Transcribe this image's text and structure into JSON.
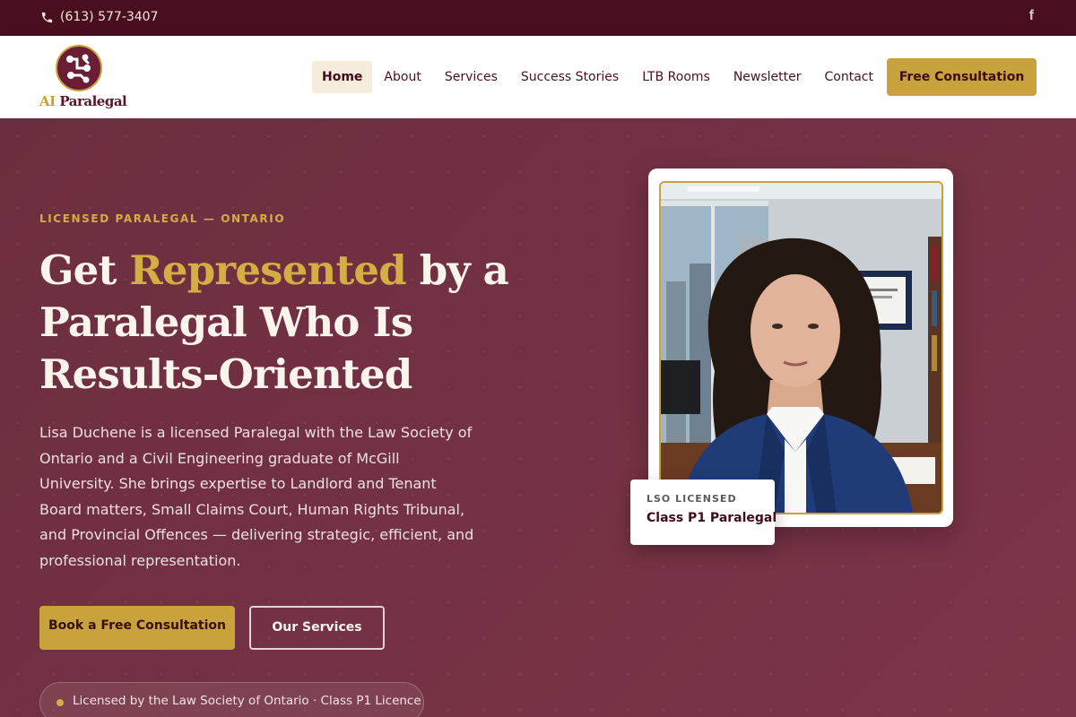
{
  "topbar": {
    "phone": "(613) 577-3407",
    "phone_icon": "phone-icon",
    "social_icon": "facebook-icon",
    "social_glyph": "f"
  },
  "header": {
    "logo_text_ai": "AI",
    "logo_text_rest": "Paralegal",
    "nav": [
      {
        "label": "Home",
        "active": true
      },
      {
        "label": "About"
      },
      {
        "label": "Services"
      },
      {
        "label": "Success Stories"
      },
      {
        "label": "LTB Rooms"
      },
      {
        "label": "Newsletter"
      },
      {
        "label": "Contact"
      }
    ],
    "cta_label": "Free Consultation"
  },
  "hero": {
    "eyebrow": "LICENSED PARALEGAL — ONTARIO",
    "headline_pre": "Get ",
    "headline_highlight": "Represented",
    "headline_post": " by a Paralegal Who Is Results-Oriented",
    "lede": "Lisa Duchene is a licensed Paralegal with the Law Society of Ontario and a Civil Engineering graduate of McGill University. She brings expertise to Landlord and Tenant Board matters, Small Claims Court, Human Rights Tribunal, and Provincial Offences — delivering strategic, efficient, and professional representation.",
    "primary_button": "Book a Free Consultation",
    "secondary_button": "Our Services",
    "licence_text": "Licensed by the Law Society of Ontario · Class P1 Licence"
  },
  "badge": {
    "label": "LSO LICENSED",
    "value": "Class P1 Paralegal"
  },
  "colors": {
    "maroon": "#5a1628",
    "maroon_dark": "#4a0f1f",
    "gold": "#c8a23a",
    "cream": "#f5ecdc"
  }
}
